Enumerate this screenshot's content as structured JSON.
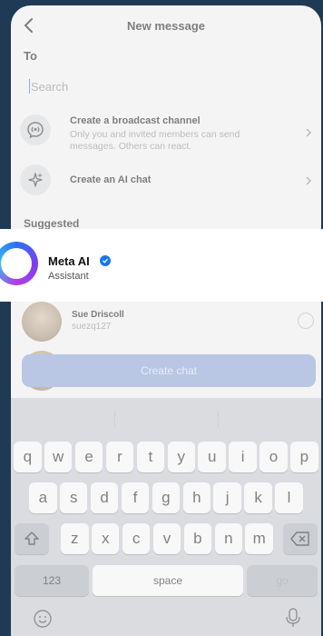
{
  "header": {
    "title": "New message"
  },
  "to_label": "To",
  "search": {
    "placeholder": "Search",
    "value": ""
  },
  "options": [
    {
      "title": "Create a broadcast channel",
      "subtitle": "Only you and invited members can send messages. Others can react.",
      "icon": "broadcast-icon"
    },
    {
      "title": "Create an AI chat",
      "icon": "sparkle-icon"
    }
  ],
  "section_label": "Suggested",
  "meta_ai": {
    "name": "Meta AI",
    "subtitle": "Assistant",
    "verified": true
  },
  "contacts": [
    {
      "name": "Sue Driscoll",
      "username": "suezq127"
    }
  ],
  "create_button": "Create chat",
  "keyboard": {
    "row1": [
      "q",
      "w",
      "e",
      "r",
      "t",
      "y",
      "u",
      "i",
      "o",
      "p"
    ],
    "row2": [
      "a",
      "s",
      "d",
      "f",
      "g",
      "h",
      "j",
      "k",
      "l"
    ],
    "row3": [
      "z",
      "x",
      "c",
      "v",
      "b",
      "n",
      "m"
    ],
    "numbers_key": "123",
    "space_key": "space",
    "go_key": "go"
  },
  "colors": {
    "accent": "#1877f2",
    "create_button": "#8aa4d8",
    "background": "#1e3a55"
  }
}
